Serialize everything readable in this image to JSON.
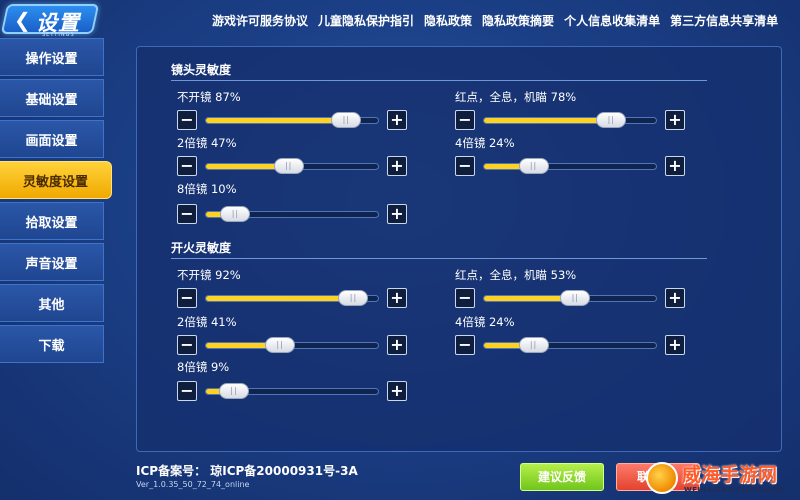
{
  "header": {
    "back_glyph": "❮",
    "title": "设置",
    "title_sub": "SETTINGS",
    "links": [
      "游戏许可服务协议",
      "儿童隐私保护指引",
      "隐私政策",
      "隐私政策摘要",
      "个人信息收集清单",
      "第三方信息共享清单"
    ]
  },
  "sidebar": {
    "items": [
      "操作设置",
      "基础设置",
      "画面设置",
      "灵敏度设置",
      "拾取设置",
      "声音设置",
      "其他",
      "下载"
    ],
    "active_index": 3
  },
  "sections": [
    {
      "title": "镜头灵敏度",
      "sliders": [
        {
          "label": "不开镜 87%",
          "value": 0.87
        },
        {
          "label": "红点，全息，机瞄 78%",
          "value": 0.78
        },
        {
          "label": "2倍镜 47%",
          "value": 0.47
        },
        {
          "label": "4倍镜 24%",
          "value": 0.24
        },
        {
          "label": "8倍镜 10%",
          "value": 0.1
        }
      ]
    },
    {
      "title": "开火灵敏度",
      "sliders": [
        {
          "label": "不开镜 92%",
          "value": 0.92
        },
        {
          "label": "红点，全息，机瞄 53%",
          "value": 0.53
        },
        {
          "label": "2倍镜 41%",
          "value": 0.41
        },
        {
          "label": "4倍镜 24%",
          "value": 0.24
        },
        {
          "label": "8倍镜 9%",
          "value": 0.09
        }
      ]
    }
  ],
  "controls": {
    "minus": "−",
    "plus": "+",
    "thumb_grip": "||"
  },
  "footer": {
    "icp": "ICP备案号： 琼ICP备20000931号-3A",
    "version": "Ver_1.0.35_50_72_74_online",
    "feedback_button": "建议反馈",
    "contact_button": "联"
  },
  "watermark": {
    "name": "威海手游网",
    "sub": "WEIHAISHOUYOUWANG"
  },
  "colors": {
    "accent": "#ffd21f",
    "active_tab": "#f0a900",
    "panel": "#16306e",
    "feedback": "#6fc51c",
    "contact": "#e2432e"
  }
}
